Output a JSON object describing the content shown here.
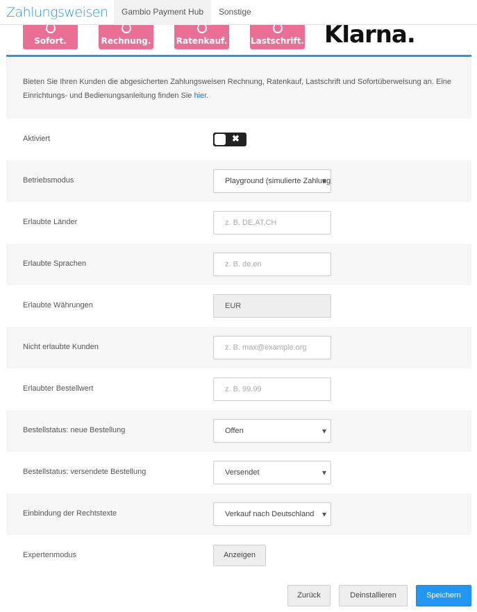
{
  "header": {
    "title": "Zahlungsweisen",
    "tabs": [
      {
        "label": "Gambio Payment Hub",
        "active": true
      },
      {
        "label": "Sonstige",
        "active": false
      }
    ]
  },
  "logos": [
    "Sofort.",
    "Rechnung.",
    "Ratenkauf.",
    "Lastschrift.",
    "Klarna."
  ],
  "info": {
    "text": "Bieten Sie Ihren Kunden die abgesicherten Zahlungsweisen Rechnung, Ratenkauf, Lastschrift und Sofortüberweisung an. Eine Einrichtungs- und Bedienungsanleitung finden Sie ",
    "link": "hier",
    "end": "."
  },
  "fields": {
    "aktiviert": {
      "label": "Aktiviert",
      "value": false,
      "off_icon": "✖"
    },
    "betriebsmodus": {
      "label": "Betriebsmodus",
      "value": "Playground (simulierte Zahlungen)"
    },
    "laender": {
      "label": "Erlaubte Länder",
      "placeholder": "z. B. DE,AT,CH"
    },
    "sprachen": {
      "label": "Erlaubte Sprachen",
      "placeholder": "z. B. de,en"
    },
    "waehrungen": {
      "label": "Erlaubte Währungen",
      "value": "EUR"
    },
    "kunden": {
      "label": "Nicht erlaubte Kunden",
      "placeholder": "z. B. max@example.org"
    },
    "bestellwert": {
      "label": "Erlaubter Bestellwert",
      "placeholder": "z. B. 99.99"
    },
    "status_neu": {
      "label": "Bestellstatus: neue Bestellung",
      "value": "Offen"
    },
    "status_versendet": {
      "label": "Bestellstatus: versendete Bestellung",
      "value": "Versendet"
    },
    "rechtstexte": {
      "label": "Einbindung der Rechtstexte",
      "value": "Verkauf nach Deutschland"
    },
    "experten": {
      "label": "Expertenmodus",
      "button": "Anzeigen"
    }
  },
  "actions": {
    "back": "Zurück",
    "uninstall": "Deinstallieren",
    "save": "Speichern"
  }
}
